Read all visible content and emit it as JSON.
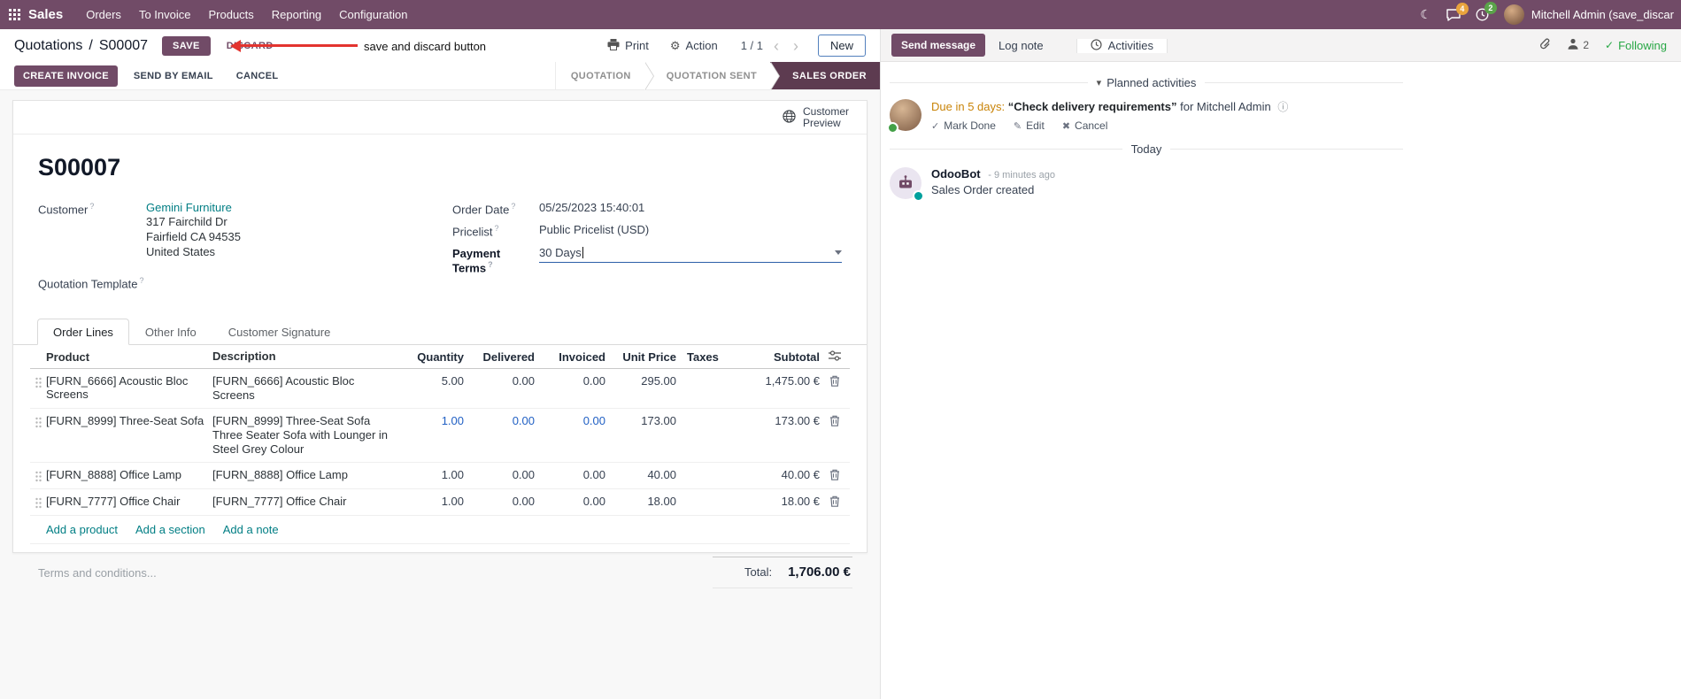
{
  "ui": {
    "help_marker": "?"
  },
  "icons": {
    "moon": "☾",
    "gear": "⚙",
    "prev": "‹",
    "next": "›",
    "caret_down": "▾",
    "check": "✓",
    "pencil": "✎",
    "cross": "✖",
    "info": "ⓘ",
    "separator": "/"
  },
  "nav": {
    "app_name": "Sales",
    "menus": [
      "Orders",
      "To Invoice",
      "Products",
      "Reporting",
      "Configuration"
    ],
    "messages_badge": "4",
    "activities_badge": "2",
    "user_name": "Mitchell Admin (save_discar"
  },
  "control_panel": {
    "breadcrumb_parent": "Quotations",
    "breadcrumb_current": "S00007",
    "save": "SAVE",
    "discard": "DISCARD",
    "print": "Print",
    "action": "Action",
    "pager": "1 / 1",
    "new": "New"
  },
  "annotation": {
    "text": "save and discard button"
  },
  "statusbar": {
    "create_invoice": "CREATE INVOICE",
    "send_by_email": "SEND BY EMAIL",
    "cancel": "CANCEL",
    "stages": [
      {
        "label": "QUOTATION",
        "active": false
      },
      {
        "label": "QUOTATION SENT",
        "active": false
      },
      {
        "label": "SALES ORDER",
        "active": true
      }
    ]
  },
  "sheet": {
    "customer_preview": "Customer Preview",
    "title": "S00007",
    "customer_label": "Customer",
    "customer_name": "Gemini Furniture",
    "address_line1": "317 Fairchild Dr",
    "address_line2": "Fairfield CA 94535",
    "address_line3": "United States",
    "quotation_template_label": "Quotation Template",
    "order_date_label": "Order Date",
    "order_date_value": "05/25/2023 15:40:01",
    "pricelist_label": "Pricelist",
    "pricelist_value": "Public Pricelist (USD)",
    "payment_terms_label": "Payment Terms",
    "payment_terms_value": "30 Days",
    "tabs": [
      "Order Lines",
      "Other Info",
      "Customer Signature"
    ],
    "table": {
      "headers": {
        "product": "Product",
        "description": "Description",
        "quantity": "Quantity",
        "delivered": "Delivered",
        "invoiced": "Invoiced",
        "unit_price": "Unit Price",
        "taxes": "Taxes",
        "subtotal": "Subtotal"
      },
      "rows": [
        {
          "product": "[FURN_6666] Acoustic Bloc Screens",
          "description": "[FURN_6666] Acoustic Bloc Screens",
          "description2": "",
          "quantity": "5.00",
          "delivered": "0.00",
          "invoiced": "0.00",
          "unit_price": "295.00",
          "taxes": "",
          "subtotal": "1,475.00 €"
        },
        {
          "product": "[FURN_8999] Three-Seat Sofa",
          "description": "[FURN_8999] Three-Seat Sofa",
          "description2": "Three Seater Sofa with Lounger in Steel Grey Colour",
          "quantity": "1.00",
          "delivered": "0.00",
          "invoiced": "0.00",
          "unit_price": "173.00",
          "taxes": "",
          "subtotal": "173.00 €"
        },
        {
          "product": "[FURN_8888] Office Lamp",
          "description": "[FURN_8888] Office Lamp",
          "description2": "",
          "quantity": "1.00",
          "delivered": "0.00",
          "invoiced": "0.00",
          "unit_price": "40.00",
          "taxes": "",
          "subtotal": "40.00 €"
        },
        {
          "product": "[FURN_7777] Office Chair",
          "description": "[FURN_7777] Office Chair",
          "description2": "",
          "quantity": "1.00",
          "delivered": "0.00",
          "invoiced": "0.00",
          "unit_price": "18.00",
          "taxes": "",
          "subtotal": "18.00 €"
        }
      ],
      "add_product": "Add a product",
      "add_section": "Add a section",
      "add_note": "Add a note"
    },
    "terms_placeholder": "Terms and conditions...",
    "total_label": "Total:",
    "total_value": "1,706.00 €"
  },
  "chatter": {
    "send_message": "Send message",
    "log_note": "Log note",
    "activities": "Activities",
    "followers_count": "2",
    "following": "Following",
    "planned_activities": "Planned activities",
    "activity": {
      "due": "Due in 5 days:",
      "summary": "“Check delivery requirements”",
      "assignee": "for Mitchell Admin",
      "mark_done": "Mark Done",
      "edit": "Edit",
      "cancel": "Cancel"
    },
    "date_separator": "Today",
    "message": {
      "author": "OdooBot",
      "timestamp": "- 9 minutes ago",
      "body": "Sales Order created"
    }
  },
  "colors": {
    "brand": "#714B67",
    "link": "#017E84",
    "stage_active_bg": "#5D3B50",
    "edited_value": "#2160C4",
    "annotation_red": "#E3342F",
    "activity_due": "#C98409"
  }
}
